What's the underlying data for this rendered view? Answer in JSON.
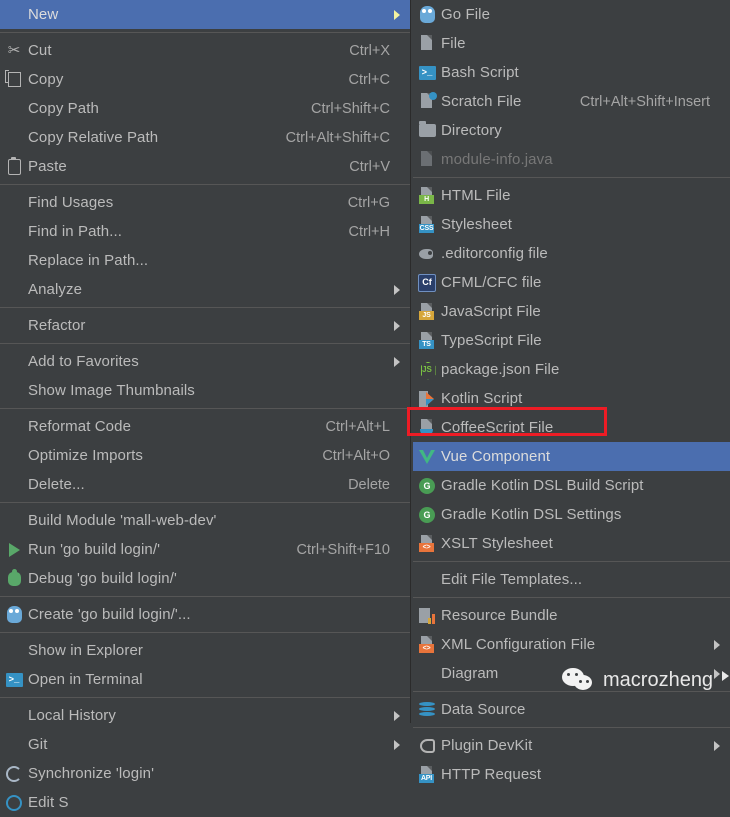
{
  "theme": {
    "menu_bg": "#3c3f41",
    "selection_bg": "#4b6eaf",
    "text": "#bbbbbb",
    "accel_text": "#a5a5a5",
    "separator": "#565656",
    "annotation_red": "#ee1c25"
  },
  "context_menu": {
    "name": "editor-context-menu",
    "groups": [
      {
        "items": [
          {
            "label": "New",
            "accel": "",
            "icon": "",
            "submenu": true,
            "selected": true
          }
        ]
      },
      {
        "items": [
          {
            "label": "Cut",
            "accel": "Ctrl+X",
            "icon": "scissors-icon",
            "submenu": false
          },
          {
            "label": "Copy",
            "accel": "Ctrl+C",
            "icon": "copy-icon",
            "submenu": false
          },
          {
            "label": "Copy Path",
            "accel": "Ctrl+Shift+C",
            "icon": "",
            "submenu": false
          },
          {
            "label": "Copy Relative Path",
            "accel": "Ctrl+Alt+Shift+C",
            "icon": "",
            "submenu": false
          },
          {
            "label": "Paste",
            "accel": "Ctrl+V",
            "icon": "clipboard-icon",
            "submenu": false
          }
        ]
      },
      {
        "items": [
          {
            "label": "Find Usages",
            "accel": "Ctrl+G",
            "icon": "",
            "submenu": false
          },
          {
            "label": "Find in Path...",
            "accel": "Ctrl+H",
            "icon": "",
            "submenu": false
          },
          {
            "label": "Replace in Path...",
            "accel": "",
            "icon": "",
            "submenu": false
          },
          {
            "label": "Analyze",
            "accel": "",
            "icon": "",
            "submenu": true
          }
        ]
      },
      {
        "items": [
          {
            "label": "Refactor",
            "accel": "",
            "icon": "",
            "submenu": true
          }
        ]
      },
      {
        "items": [
          {
            "label": "Add to Favorites",
            "accel": "",
            "icon": "",
            "submenu": true
          },
          {
            "label": "Show Image Thumbnails",
            "accel": "",
            "icon": "",
            "submenu": false
          }
        ]
      },
      {
        "items": [
          {
            "label": "Reformat Code",
            "accel": "Ctrl+Alt+L",
            "icon": "",
            "submenu": false
          },
          {
            "label": "Optimize Imports",
            "accel": "Ctrl+Alt+O",
            "icon": "",
            "submenu": false
          },
          {
            "label": "Delete...",
            "accel": "Delete",
            "icon": "",
            "submenu": false
          }
        ]
      },
      {
        "items": [
          {
            "label": "Build Module 'mall-web-dev'",
            "accel": "",
            "icon": "",
            "submenu": false
          },
          {
            "label": "Run 'go build login/'",
            "accel": "Ctrl+Shift+F10",
            "icon": "run-icon",
            "submenu": false
          },
          {
            "label": "Debug 'go build login/'",
            "accel": "",
            "icon": "debug-icon",
            "submenu": false
          }
        ]
      },
      {
        "items": [
          {
            "label": "Create 'go build login/'...",
            "accel": "",
            "icon": "go-gopher-icon",
            "submenu": false
          }
        ]
      },
      {
        "items": [
          {
            "label": "Show in Explorer",
            "accel": "",
            "icon": "",
            "submenu": false
          },
          {
            "label": "Open in Terminal",
            "accel": "",
            "icon": "terminal-icon",
            "submenu": false
          }
        ]
      },
      {
        "items": [
          {
            "label": "Local History",
            "accel": "",
            "icon": "",
            "submenu": true
          },
          {
            "label": "Git",
            "accel": "",
            "icon": "",
            "submenu": true
          },
          {
            "label": "Synchronize 'login'",
            "accel": "",
            "icon": "synchronize-icon",
            "submenu": false
          },
          {
            "label": "Edit S",
            "accel": "",
            "icon": "edit-scopes-icon",
            "submenu": false,
            "clipped": true
          }
        ]
      }
    ]
  },
  "new_submenu": {
    "name": "new-submenu",
    "groups": [
      {
        "items": [
          {
            "label": "Go File",
            "accel": "",
            "icon": "go-gopher-icon",
            "submenu": false
          },
          {
            "label": "File",
            "accel": "",
            "icon": "file-icon",
            "submenu": false
          },
          {
            "label": "Bash Script",
            "accel": "",
            "icon": "bash-script-icon",
            "submenu": false
          },
          {
            "label": "Scratch File",
            "accel": "Ctrl+Alt+Shift+Insert",
            "icon": "scratch-file-icon",
            "submenu": false
          },
          {
            "label": "Directory",
            "accel": "",
            "icon": "directory-icon",
            "submenu": false
          },
          {
            "label": "module-info.java",
            "accel": "",
            "icon": "java-file-icon",
            "submenu": false,
            "disabled": true
          }
        ]
      },
      {
        "items": [
          {
            "label": "HTML File",
            "accel": "",
            "icon": "html-file-icon",
            "badge": "H",
            "badge_color": "#7ab648",
            "submenu": false
          },
          {
            "label": "Stylesheet",
            "accel": "",
            "icon": "css-file-icon",
            "badge": "CSS",
            "badge_color": "#3592c4",
            "submenu": false
          },
          {
            "label": ".editorconfig file",
            "accel": "",
            "icon": "editorconfig-icon",
            "submenu": false
          },
          {
            "label": "CFML/CFC file",
            "accel": "",
            "icon": "cfml-file-icon",
            "submenu": false
          },
          {
            "label": "JavaScript File",
            "accel": "",
            "icon": "javascript-file-icon",
            "badge": "JS",
            "badge_color": "#d6a63a",
            "submenu": false
          },
          {
            "label": "TypeScript File",
            "accel": "",
            "icon": "typescript-file-icon",
            "badge": "TS",
            "badge_color": "#3592c4",
            "submenu": false
          },
          {
            "label": "package.json File",
            "accel": "",
            "icon": "package-json-icon",
            "submenu": false
          },
          {
            "label": "Kotlin Script",
            "accel": "",
            "icon": "kotlin-script-icon",
            "submenu": false
          },
          {
            "label": "CoffeeScript File",
            "accel": "",
            "icon": "coffeescript-file-icon",
            "submenu": false
          },
          {
            "label": "Vue Component",
            "accel": "",
            "icon": "vue-component-icon",
            "submenu": false,
            "selected": true
          },
          {
            "label": "Gradle Kotlin DSL Build Script",
            "accel": "",
            "icon": "gradle-icon",
            "submenu": false
          },
          {
            "label": "Gradle Kotlin DSL Settings",
            "accel": "",
            "icon": "gradle-icon",
            "submenu": false
          },
          {
            "label": "XSLT Stylesheet",
            "accel": "",
            "icon": "xslt-file-icon",
            "badge": "<>",
            "badge_color": "#e8743b",
            "submenu": false
          }
        ]
      },
      {
        "items": [
          {
            "label": "Edit File Templates...",
            "accel": "",
            "icon": "",
            "submenu": false
          }
        ]
      },
      {
        "items": [
          {
            "label": "Resource Bundle",
            "accel": "",
            "icon": "resource-bundle-icon",
            "submenu": false
          },
          {
            "label": "XML Configuration File",
            "accel": "",
            "icon": "xml-config-file-icon",
            "badge": "<>",
            "badge_color": "#e8743b",
            "submenu": true
          },
          {
            "label": "Diagram",
            "accel": "",
            "icon": "",
            "submenu": true
          }
        ]
      },
      {
        "items": [
          {
            "label": "Data Source",
            "accel": "",
            "icon": "data-source-icon",
            "submenu": false
          }
        ]
      },
      {
        "items": [
          {
            "label": "Plugin DevKit",
            "accel": "",
            "icon": "plugin-devkit-icon",
            "submenu": true
          },
          {
            "label": "HTTP Request",
            "accel": "",
            "icon": "http-request-icon",
            "badge": "API",
            "badge_color": "#3592c4",
            "submenu": false
          }
        ]
      }
    ]
  },
  "annotation": {
    "name": "highlight-rectangle",
    "target": "Vue Component"
  },
  "watermark": {
    "name": "wechat-watermark",
    "text": "macrozheng",
    "icon": "wechat-logo-icon"
  }
}
